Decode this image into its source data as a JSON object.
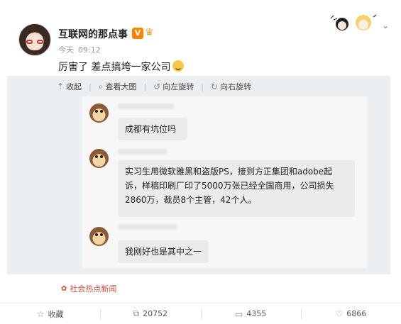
{
  "post": {
    "username": "互联网的那点事",
    "badge_v": "V",
    "meta_time_day": "今天",
    "meta_time": "09:12",
    "text": "厉害了 差点搞垮一家公司"
  },
  "toolbar": {
    "collapse_label": "收起",
    "view_large_label": "查看大图",
    "rotate_left_label": "向左旋转",
    "rotate_right_label": "向右旋转"
  },
  "chat": {
    "messages": [
      {
        "text": "成都有坑位吗"
      },
      {
        "lines": [
          "实习生用微软雅黑和盗版PS，接到方正集团和adobe起",
          "诉，样稿印刷厂印了5000万张已经全国商用，公司损失",
          "2860万，裁员8个主管，42个人。"
        ]
      },
      {
        "text": "我刚好也是其中之一"
      }
    ]
  },
  "topic_tag": "社会热点新闻",
  "actions": {
    "favorite_label": "收藏",
    "repost_count": "20752",
    "comment_count": "4355",
    "like_count": "6866"
  },
  "colors": {
    "accent": "#ff8200",
    "tag": "#d04b3a"
  },
  "icons": [
    "avatar",
    "v-badge-icon",
    "crown-icon",
    "chevron-down-icon",
    "collapse-icon",
    "magnifier-icon",
    "rotate-left-icon",
    "rotate-right-icon",
    "star-icon",
    "repost-icon",
    "comment-icon",
    "like-icon"
  ]
}
